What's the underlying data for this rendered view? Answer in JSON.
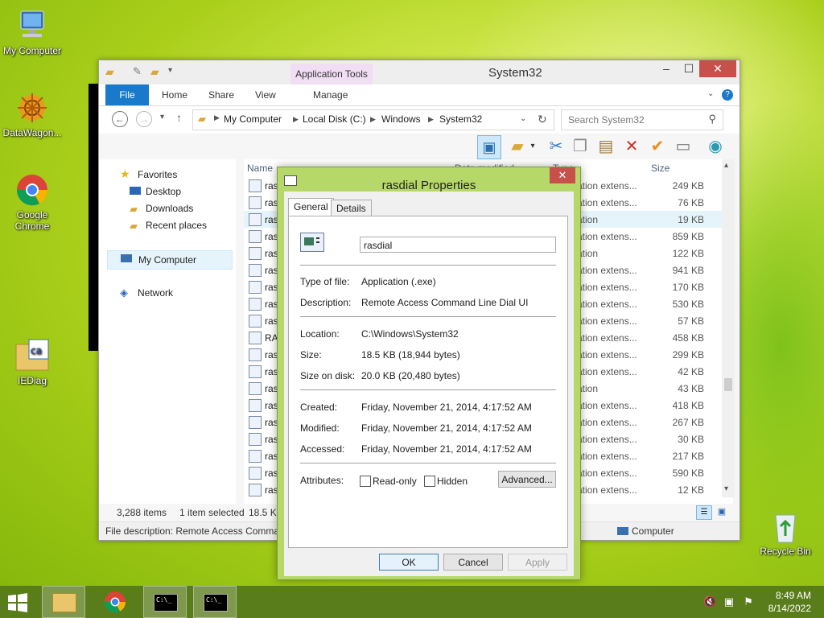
{
  "desktop": {
    "icons": [
      {
        "label": "My Computer"
      },
      {
        "label": "DataWagon..."
      },
      {
        "label": "Google Chrome"
      },
      {
        "label": "IEDiag"
      },
      {
        "label": "Recycle Bin"
      }
    ]
  },
  "explorer": {
    "title": "System32",
    "ribbon_tabs": [
      "File",
      "Home",
      "Share",
      "View",
      "Manage"
    ],
    "contextual_tab": "Application Tools",
    "breadcrumb": [
      "My Computer",
      "Local Disk (C:)",
      "Windows",
      "System32"
    ],
    "search_placeholder": "Search System32",
    "nav": {
      "favorites": "Favorites",
      "favorites_items": [
        "Desktop",
        "Downloads",
        "Recent places"
      ],
      "computer": "My Computer",
      "network": "Network"
    },
    "columns": {
      "name": "Name",
      "date": "Date modified",
      "type": "Type",
      "size": "Size"
    },
    "rows": [
      {
        "name": "ras",
        "type": "ation extens...",
        "size": "249 KB"
      },
      {
        "name": "ras",
        "type": "ation extens...",
        "size": "76 KB"
      },
      {
        "name": "ras",
        "type": "ation",
        "size": "19 KB"
      },
      {
        "name": "ras",
        "type": "ation extens...",
        "size": "859 KB"
      },
      {
        "name": "ras",
        "type": "ation",
        "size": "122 KB"
      },
      {
        "name": "ras",
        "type": "ation extens...",
        "size": "941 KB"
      },
      {
        "name": "ras",
        "type": "ation extens...",
        "size": "170 KB"
      },
      {
        "name": "ras",
        "type": "ation extens...",
        "size": "530 KB"
      },
      {
        "name": "ras",
        "type": "ation extens...",
        "size": "57 KB"
      },
      {
        "name": "RA",
        "type": "ation extens...",
        "size": "458 KB"
      },
      {
        "name": "ras",
        "type": "ation extens...",
        "size": "299 KB"
      },
      {
        "name": "ras",
        "type": "ation extens...",
        "size": "42 KB"
      },
      {
        "name": "ras",
        "type": "ation",
        "size": "43 KB"
      },
      {
        "name": "ras",
        "type": "ation extens...",
        "size": "418 KB"
      },
      {
        "name": "ras",
        "type": "ation extens...",
        "size": "267 KB"
      },
      {
        "name": "ras",
        "type": "ation extens...",
        "size": "30 KB"
      },
      {
        "name": "ras",
        "type": "ation extens...",
        "size": "217 KB"
      },
      {
        "name": "ras",
        "type": "ation extens...",
        "size": "590 KB"
      },
      {
        "name": "ras",
        "type": "ation extens...",
        "size": "12 KB"
      }
    ],
    "status": {
      "items": "3,288 items",
      "selected": "1 item selected",
      "size_partial": "18.5 KE"
    },
    "details_bar": {
      "description": "File description: Remote Access Comma",
      "location": "Computer"
    }
  },
  "dialog": {
    "title": "rasdial Properties",
    "tabs": [
      "General",
      "Details"
    ],
    "filename": "rasdial",
    "type_label": "Type of file:",
    "type_value": "Application (.exe)",
    "desc_label": "Description:",
    "desc_value": "Remote Access Command Line Dial UI",
    "location_label": "Location:",
    "location_value": "C:\\Windows\\System32",
    "size_label": "Size:",
    "size_value": "18.5 KB (18,944 bytes)",
    "disk_label": "Size on disk:",
    "disk_value": "20.0 KB (20,480 bytes)",
    "created_label": "Created:",
    "created_value": "Friday, November 21, 2014, 4:17:52 AM",
    "modified_label": "Modified:",
    "modified_value": "Friday, November 21, 2014, 4:17:52 AM",
    "accessed_label": "Accessed:",
    "accessed_value": "Friday, November 21, 2014, 4:17:52 AM",
    "attributes_label": "Attributes:",
    "readonly_label": "Read-only",
    "hidden_label": "Hidden",
    "advanced_label": "Advanced...",
    "ok_label": "OK",
    "cancel_label": "Cancel",
    "apply_label": "Apply"
  },
  "taskbar": {
    "time": "8:49 AM",
    "date": "8/14/2022",
    "cmd_icon_text": "C:\\_"
  },
  "colors": {
    "accent": "#1979ca",
    "dialog_frame": "#b6d869",
    "taskbar": "#5a7d1c",
    "close": "#c7504a"
  }
}
